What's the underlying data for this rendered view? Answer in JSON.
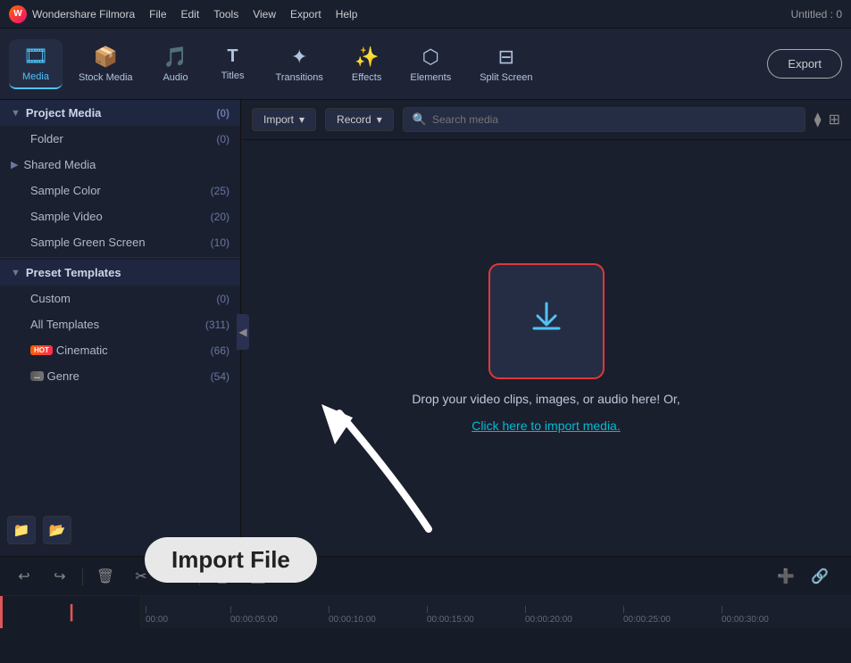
{
  "app": {
    "name": "Wondershare Filmora",
    "title": "Untitled : 0",
    "logo": "W"
  },
  "menubar": {
    "items": [
      "File",
      "Edit",
      "Tools",
      "View",
      "Export",
      "Help"
    ]
  },
  "toolbar": {
    "items": [
      {
        "id": "media",
        "label": "Media",
        "icon": "🎞",
        "active": true
      },
      {
        "id": "stock-media",
        "label": "Stock Media",
        "icon": "📦",
        "active": false
      },
      {
        "id": "audio",
        "label": "Audio",
        "icon": "🎵",
        "active": false
      },
      {
        "id": "titles",
        "label": "Titles",
        "icon": "T",
        "active": false
      },
      {
        "id": "transitions",
        "label": "Transitions",
        "icon": "✦",
        "active": false
      },
      {
        "id": "effects",
        "label": "Effects",
        "icon": "✨",
        "active": false
      },
      {
        "id": "elements",
        "label": "Elements",
        "icon": "⬡",
        "active": false
      },
      {
        "id": "split-screen",
        "label": "Split Screen",
        "icon": "⊟",
        "active": false
      }
    ],
    "export_label": "Export"
  },
  "sidebar": {
    "groups": [
      {
        "id": "project-media",
        "label": "Project Media",
        "count": "(0)",
        "expanded": true,
        "children": [
          {
            "id": "folder",
            "label": "Folder",
            "count": "(0)"
          },
          {
            "id": "shared-media",
            "label": "Shared Media",
            "count": "",
            "expandable": true
          },
          {
            "id": "sample-color",
            "label": "Sample Color",
            "count": "(25)"
          },
          {
            "id": "sample-video",
            "label": "Sample Video",
            "count": "(20)"
          },
          {
            "id": "sample-green-screen",
            "label": "Sample Green Screen",
            "count": "(10)"
          }
        ]
      },
      {
        "id": "preset-templates",
        "label": "Preset Templates",
        "count": "",
        "expanded": true,
        "children": [
          {
            "id": "custom",
            "label": "Custom",
            "count": "(0)"
          },
          {
            "id": "all-templates",
            "label": "All Templates",
            "count": "(311)"
          },
          {
            "id": "cinematic",
            "label": "Cinematic",
            "count": "(66)",
            "hot": true
          },
          {
            "id": "genre",
            "label": "Genre",
            "count": "(54)",
            "hot": false
          }
        ]
      }
    ],
    "footer_buttons": [
      {
        "id": "add-folder",
        "icon": "📁+"
      },
      {
        "id": "folder-browse",
        "icon": "📂"
      }
    ]
  },
  "content": {
    "import_label": "Import",
    "record_label": "Record",
    "search_placeholder": "Search media",
    "drop_text": "Drop your video clips, images, or audio here! Or,",
    "drop_link": "Click here to import media."
  },
  "import_annotation": {
    "label": "Import File"
  },
  "timeline": {
    "buttons": [
      {
        "id": "undo",
        "icon": "↩"
      },
      {
        "id": "redo",
        "icon": "↪"
      },
      {
        "id": "delete",
        "icon": "🗑"
      },
      {
        "id": "cut",
        "icon": "✂"
      },
      {
        "id": "disable-clip",
        "icon": "🚫",
        "type": "strike"
      },
      {
        "id": "color-correct",
        "icon": "🎚"
      },
      {
        "id": "audio-stretch",
        "icon": "🎛"
      }
    ],
    "extra_buttons": [
      {
        "id": "add-track",
        "icon": "➕"
      },
      {
        "id": "link",
        "icon": "🔗"
      }
    ],
    "ruler_marks": [
      "00:00",
      "00:00:05:00",
      "00:00:10:00",
      "00:00:15:00",
      "00:00:20:00",
      "00:00:25:00",
      "00:00:30:00"
    ]
  }
}
